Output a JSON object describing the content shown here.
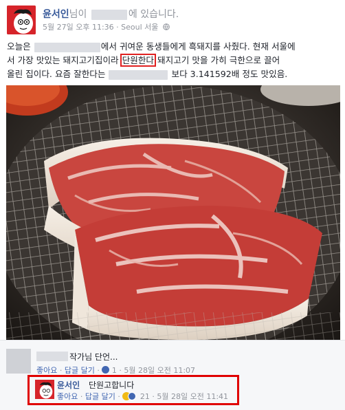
{
  "post": {
    "author_name": "윤서인",
    "author_suffix": "님이",
    "location_suffix": "에 있습니다.",
    "timestamp": "5월 27일 오후 11:36",
    "separator": "·",
    "location": "Seoul 서울",
    "privacy_icon": "globe-icon",
    "body_lines": {
      "l1_pre": "오늘은",
      "l1_post": "에서 귀여운 동생들에게 흑돼지를 사줬다. 현재 서울에",
      "l2_pre": "서 가장 맛있는 돼지고기집이라",
      "l2_highlight": "단원한다",
      "l2_post": "돼지고기 맛을 가히 극한으로 끌어",
      "l3_pre": "올린 집이다. 요즘 잘한다는",
      "l3_post": "보다 3.141592배 정도 맛있음."
    },
    "photo_subject": "raw-pork-on-grill"
  },
  "comments": [
    {
      "text": "작가님 단언...",
      "like": "좋아요",
      "reply": "답글 달기",
      "like_count": "1",
      "time": "5월 28일 오전 11:07"
    },
    {
      "author": "윤서인",
      "text": "단원고합니다",
      "like": "좋아요",
      "reply": "답글 달기",
      "reaction_count": "21",
      "time": "5월 28일 오전 11:41"
    }
  ],
  "colors": {
    "link_blue": "#365899",
    "action_blue": "#4267b2",
    "meta_gray": "#90949c",
    "highlight_red": "#e00000",
    "avatar_red": "#d6242a"
  }
}
